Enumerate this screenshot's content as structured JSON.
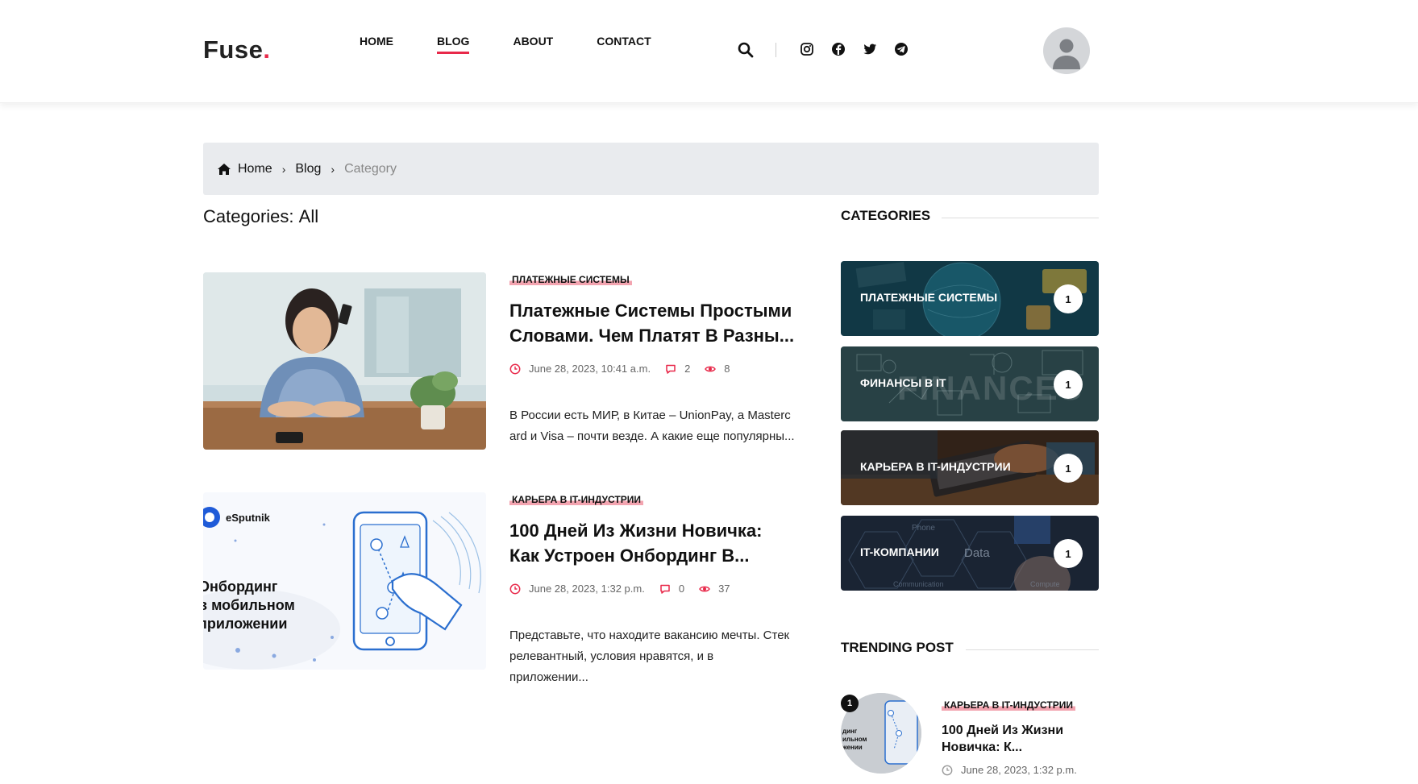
{
  "header": {
    "logo": "Fuse",
    "logo_dot": ".",
    "nav": [
      "HOME",
      "BLOG",
      "ABOUT",
      "CONTACT"
    ],
    "active_nav": "BLOG",
    "accent_color": "#e8294a"
  },
  "breadcrumb": {
    "items": [
      "Home",
      "Blog"
    ],
    "current": "Category"
  },
  "categories_heading": {
    "label": "Categories:",
    "value": "All"
  },
  "posts": [
    {
      "tag": "ПЛАТЕЖНЫЕ СИСТЕМЫ",
      "title_line1": "Платежные Системы Простыми",
      "title_line2": "Словами. Чем Платят В Разны...",
      "date": "June 28, 2023, 10:41 a.m.",
      "comments": "2",
      "views": "8",
      "excerpt_line1": "В России есть МИР, в Китае – UnionPay, а Masterc",
      "excerpt_line2": "ard и Visa – почти везде. А какие еще популярны..."
    },
    {
      "tag": "КАРЬЕРА В IT-ИНДУСТРИИ",
      "title_line1": "100 Дней Из Жизни Новичка:",
      "title_line2": "Как Устроен Онбординг В...",
      "date": "June 28, 2023, 1:32 p.m.",
      "comments": "0",
      "views": "37",
      "excerpt_line1": "Представьте, что находите вакансию мечты. Стек",
      "excerpt_line2": "релевантный, условия нравятся, и в приложении...",
      "image_text": {
        "brand": "eSputnik",
        "line1": "Онбординг",
        "line2": "в мобильном",
        "line3": "приложении"
      }
    }
  ],
  "sidebar": {
    "categories_title": "CATEGORIES",
    "categories": [
      {
        "label": "ПЛАТЕЖНЫЕ СИСТЕМЫ",
        "count": "1"
      },
      {
        "label": "ФИНАНСЫ В IT",
        "count": "1",
        "watermark": "FINANCES"
      },
      {
        "label": "КАРЬЕРА В IT-ИНДУСТРИИ",
        "count": "1"
      },
      {
        "label": "IT-КОМПАНИИ",
        "count": "1",
        "watermark_words": [
          "Phone",
          "Data",
          "Communication",
          "Compute"
        ]
      }
    ],
    "trending_title": "TRENDING POST",
    "trending": {
      "rank": "1",
      "tag": "КАРЬЕРА В IT-ИНДУСТРИИ",
      "title_line1": "100 Дней Из Жизни",
      "title_line2": "Новичка: К...",
      "date": "June 28, 2023, 1:32 p.m."
    }
  }
}
